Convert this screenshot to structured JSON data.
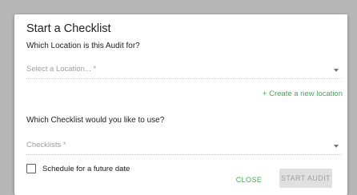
{
  "dialog": {
    "title": "Start a Checklist",
    "location_question": "Which Location is this Audit for?",
    "location_select": {
      "placeholder": "Select a Location... *"
    },
    "create_location_link": "+ Create a new location",
    "checklist_question": "Which Checklist would you like to use?",
    "checklist_select": {
      "placeholder": "Checklists *"
    },
    "schedule_checkbox": {
      "label": "Schedule for a future date",
      "checked": false
    },
    "buttons": {
      "close": "CLOSE",
      "start_audit": "START AUDIT"
    }
  },
  "colors": {
    "accent": "#3fae5a",
    "backdrop": "#b7b7b7",
    "disabled_button_bg": "#e0e0e0",
    "disabled_button_text": "#9e9e9e"
  },
  "icons": [
    "dropdown-caret-icon",
    "checkbox-unchecked-icon"
  ]
}
